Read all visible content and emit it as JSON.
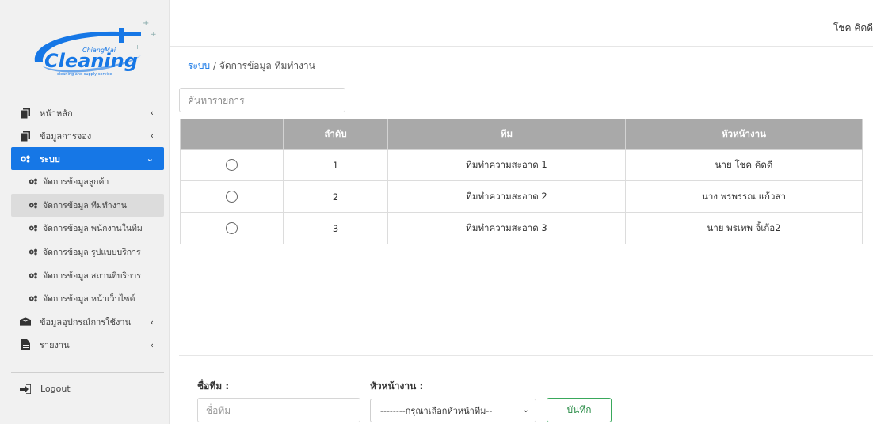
{
  "brand": {
    "logo_text": "Cleaning",
    "logo_small": "ChiangMai",
    "logo_tagline": "cleaning and supply service",
    "accent": "#1677e6"
  },
  "user": {
    "name": "โชค คิดดี"
  },
  "sidebar": {
    "items": [
      {
        "label": "หน้าหลัก",
        "icon": "copy-icon"
      },
      {
        "label": "ข้อมูลการจอง",
        "icon": "copy-icon"
      },
      {
        "label": "ระบบ",
        "icon": "gears-icon"
      }
    ],
    "subitems": [
      {
        "label": "จัดการข้อมูลลูกค้า"
      },
      {
        "label": "จัดการข้อมูล ทีมทำงาน"
      },
      {
        "label": "จัดการข้อมูล พนักงานในทีม"
      },
      {
        "label": "จัดการข้อมูล รูปแบบบริการ"
      },
      {
        "label": "จัดการข้อมูล สถานที่บริการ"
      },
      {
        "label": "จัดการข้อมูล หน้าเว็บไซต์"
      }
    ],
    "items2": [
      {
        "label": "ข้อมูลอุปกรณ์การใช้งาน",
        "icon": "box-icon"
      },
      {
        "label": "รายงาน",
        "icon": "file-icon"
      }
    ],
    "logout": "Logout"
  },
  "breadcrumb": {
    "root": "ระบบ",
    "separator": "/",
    "current": "จัดการข้อมูล ทีมทำงาน"
  },
  "search": {
    "placeholder": "ค้นหารายการ",
    "value": ""
  },
  "table": {
    "headers": [
      "",
      "ลำดับ",
      "ทีม",
      "หัวหน้างาน"
    ],
    "rows": [
      {
        "no": "1",
        "team": "ทีมทำความสะอาด 1",
        "leader": "นาย โชค คิดดี"
      },
      {
        "no": "2",
        "team": "ทีมทำความสะอาด 2",
        "leader": "นาง พรพรรณ แก้วสา"
      },
      {
        "no": "3",
        "team": "ทีมทำความสะอาด 3",
        "leader": "นาย พรเทพ จิ้เก้อ2"
      }
    ]
  },
  "form": {
    "team_label": "ชื่อทีม :",
    "team_placeholder": "ชื่อทีม",
    "leader_label": "หัวหน้างาน :",
    "leader_select": "--------กรุณาเลือกหัวหน้าทีม--",
    "save_label": "บันทึก"
  }
}
